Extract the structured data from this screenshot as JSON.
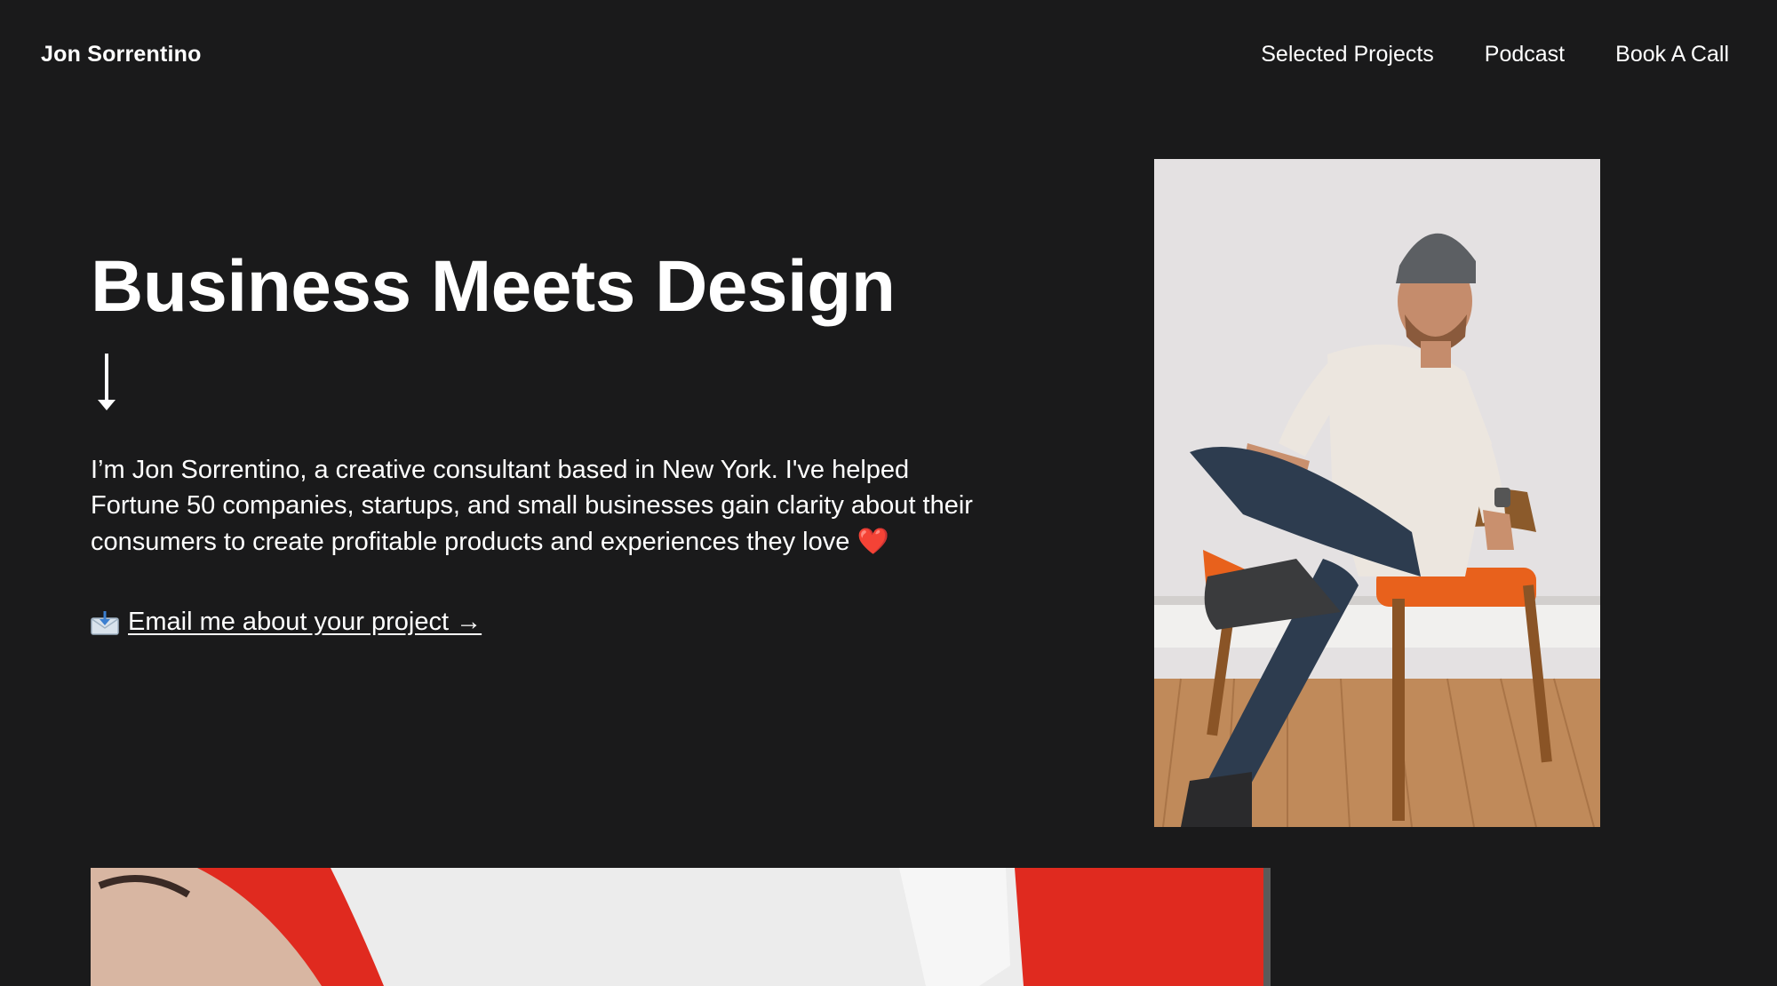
{
  "header": {
    "brand": "Jon Sorrentino",
    "nav": [
      {
        "label": "Selected Projects"
      },
      {
        "label": "Podcast"
      },
      {
        "label": "Book A Call"
      }
    ]
  },
  "hero": {
    "title": "Business Meets Design",
    "arrow_icon": "arrow-down-icon",
    "intro": "I’m Jon Sorrentino, a creative consultant based in New York. I've helped Fortune 50 companies, startups, and small businesses gain clarity about their consumers to create profitable products and experiences they love",
    "intro_emoji": "❤️",
    "cta_icon": "envelope-inbox-icon",
    "cta_label": "Email me about your project →"
  },
  "images": {
    "portrait": "portrait-photo",
    "banner": "featured-project-photo"
  },
  "colors": {
    "background": "#1a1a1b",
    "text": "#ffffff",
    "heart": "#e2231a",
    "banner_red": "#e02a1f"
  }
}
